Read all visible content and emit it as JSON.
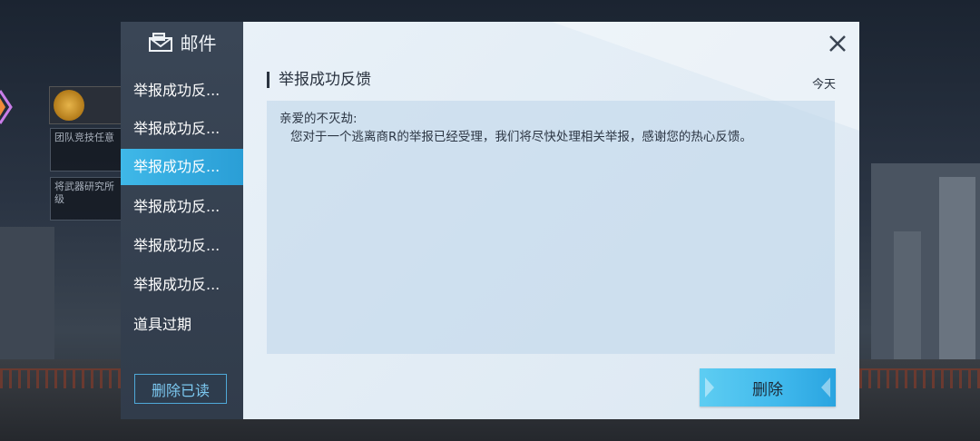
{
  "background": {
    "tasks": [
      "团队竞技任意",
      "将武器研究所\n级"
    ]
  },
  "sidebar": {
    "title": "邮件",
    "items": [
      {
        "label": "举报成功反..."
      },
      {
        "label": "举报成功反..."
      },
      {
        "label": "举报成功反...",
        "active": true
      },
      {
        "label": "举报成功反..."
      },
      {
        "label": "举报成功反..."
      },
      {
        "label": "举报成功反..."
      },
      {
        "label": "道具过期"
      }
    ],
    "delete_read_label": "删除已读"
  },
  "message": {
    "title": "举报成功反馈",
    "date": "今天",
    "greeting": "亲爱的不灭劫:",
    "body": "您对于一个逃离商R的举报已经受理，我们将尽快处理相关举报，感谢您的热心反馈。"
  },
  "actions": {
    "delete_label": "删除"
  },
  "colors": {
    "active_item": "#3fb8e8",
    "sidebar_bg": "#3a4656",
    "content_bg": "#e9f1f8",
    "delete_button": "#3fb8ec"
  }
}
